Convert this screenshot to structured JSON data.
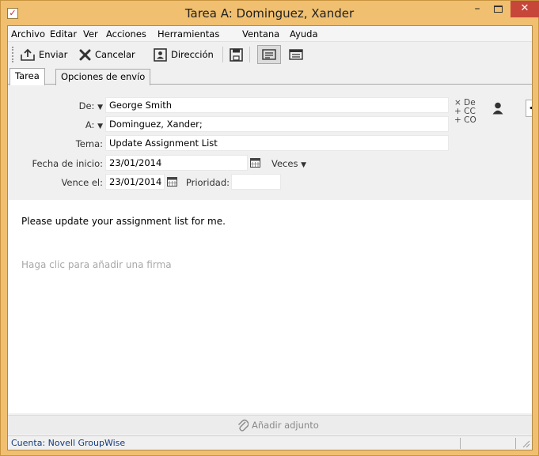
{
  "window": {
    "title": "Tarea A: Dominguez, Xander"
  },
  "menu": [
    "Archivo",
    "Editar",
    "Ver",
    "Acciones",
    "Herramientas",
    "Ventana",
    "Ayuda"
  ],
  "toolbar": {
    "send": "Enviar",
    "cancel": "Cancelar",
    "address": "Dirección"
  },
  "tabs": [
    "Tarea",
    "Opciones de envío"
  ],
  "form": {
    "from_label": "De:",
    "from_value": "George Smith",
    "to_label": "A:",
    "to_value": "Dominguez, Xander;",
    "subject_label": "Tema:",
    "subject_value": "Update Assignment List",
    "start_label": "Fecha de inicio:",
    "start_value": "23/01/2014",
    "times_label": "Veces",
    "due_label": "Vence el:",
    "due_value": "23/01/2014",
    "priority_label": "Prioridad:",
    "priority_value": "",
    "x_de": "× De",
    "plus_cc": "+ CC",
    "plus_co": "+ CO"
  },
  "body": {
    "text": "Please update your assignment list for me.",
    "signature": "Haga clic para añadir una firma"
  },
  "attach": "Añadir adjunto",
  "status": {
    "account": "Cuenta: Novell GroupWise"
  }
}
